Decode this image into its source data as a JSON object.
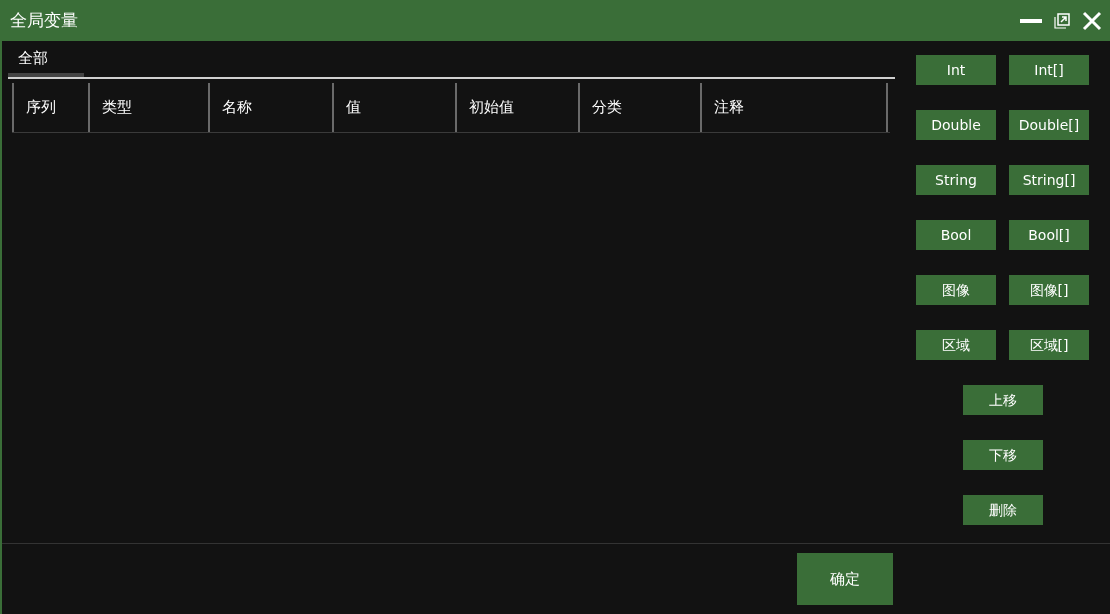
{
  "window": {
    "title": "全局变量"
  },
  "tabs": [
    {
      "label": "全部",
      "selected": true
    }
  ],
  "table": {
    "columns": [
      "序列",
      "类型",
      "名称",
      "值",
      "初始值",
      "分类",
      "注释"
    ]
  },
  "type_buttons": [
    [
      "Int",
      "Int[]"
    ],
    [
      "Double",
      "Double[]"
    ],
    [
      "String",
      "String[]"
    ],
    [
      "Bool",
      "Bool[]"
    ],
    [
      "图像",
      "图像[]"
    ],
    [
      "区域",
      "区域[]"
    ]
  ],
  "action_buttons": [
    "上移",
    "下移",
    "删除"
  ],
  "confirm_button": "确定"
}
